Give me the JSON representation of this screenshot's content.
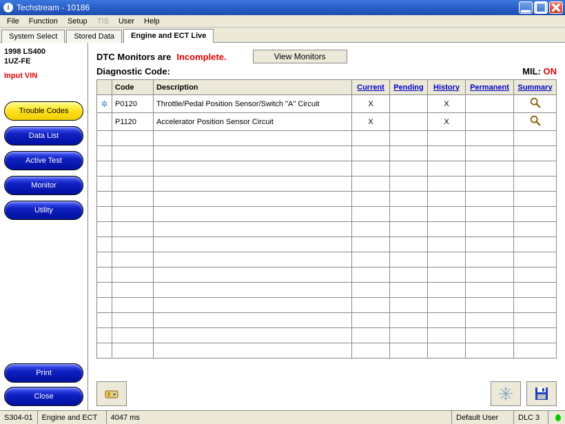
{
  "title": "Techstream - 10186",
  "menu": {
    "file": "File",
    "function": "Function",
    "setup": "Setup",
    "tis": "TIS",
    "user": "User",
    "help": "Help"
  },
  "tabs": {
    "system_select": "System Select",
    "stored_data": "Stored Data",
    "ect_live": "Engine and ECT Live"
  },
  "sidebar": {
    "vehicle_line1": "1998 LS400",
    "vehicle_line2": "1UZ-FE",
    "input_vin": "Input VIN",
    "trouble_codes": "Trouble Codes",
    "data_list": "Data List",
    "active_test": "Active Test",
    "monitor": "Monitor",
    "utility": "Utility",
    "print": "Print",
    "close": "Close"
  },
  "main": {
    "dtc_monitors_label": "DTC Monitors are",
    "incomplete": "Incomplete.",
    "view_monitors": "View Monitors",
    "diagnostic_code": "Diagnostic Code:",
    "mil_label": "MIL:",
    "mil_value": "ON",
    "headers": {
      "code": "Code",
      "description": "Description",
      "current": "Current",
      "pending": "Pending",
      "history": "History",
      "permanent": "Permanent",
      "summary": "Summary"
    },
    "rows": [
      {
        "code": "P0120",
        "desc": "Throttle/Pedal Position Sensor/Switch \"A\" Circuit",
        "current": "X",
        "pending": "",
        "history": "X",
        "permanent": ""
      },
      {
        "code": "P1120",
        "desc": "Accelerator Position Sensor Circuit",
        "current": "X",
        "pending": "",
        "history": "X",
        "permanent": ""
      }
    ]
  },
  "status": {
    "s1": "S304-01",
    "s2": "Engine and ECT",
    "s3": "4047 ms",
    "user": "Default User",
    "dlc": "DLC 3"
  }
}
